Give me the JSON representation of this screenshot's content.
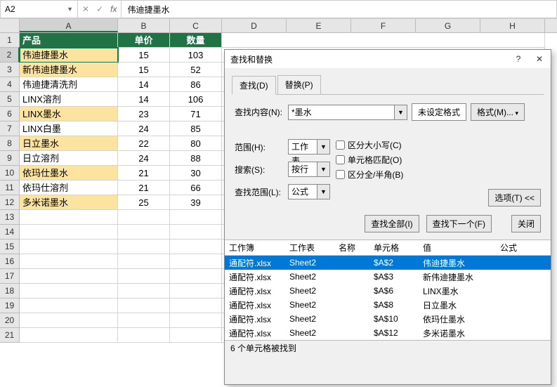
{
  "namebox": {
    "ref": "A2"
  },
  "formula_bar": {
    "value": "伟迪捷墨水"
  },
  "columns": [
    "A",
    "B",
    "C",
    "D",
    "E",
    "F",
    "G",
    "H"
  ],
  "active_col": "A",
  "active_row": 2,
  "header_row": {
    "product": "产品",
    "price": "单价",
    "qty": "数量"
  },
  "rows": [
    {
      "n": 1,
      "a": "产品",
      "b": "单价",
      "c": "数量",
      "hdr": true
    },
    {
      "n": 2,
      "a": "伟迪捷墨水",
      "b": "15",
      "c": "103",
      "hl": true,
      "active": true
    },
    {
      "n": 3,
      "a": "新伟迪捷墨水",
      "b": "15",
      "c": "52",
      "hl": true
    },
    {
      "n": 4,
      "a": "伟迪捷清洗剂",
      "b": "14",
      "c": "86"
    },
    {
      "n": 5,
      "a": "LINX溶剂",
      "b": "14",
      "c": "106"
    },
    {
      "n": 6,
      "a": "LINX墨水",
      "b": "23",
      "c": "71",
      "hl": true
    },
    {
      "n": 7,
      "a": "LINX白墨",
      "b": "24",
      "c": "85"
    },
    {
      "n": 8,
      "a": "日立墨水",
      "b": "22",
      "c": "80",
      "hl": true
    },
    {
      "n": 9,
      "a": "日立溶剂",
      "b": "24",
      "c": "88"
    },
    {
      "n": 10,
      "a": "依玛仕墨水",
      "b": "21",
      "c": "30",
      "hl": true
    },
    {
      "n": 11,
      "a": "依玛仕溶剂",
      "b": "21",
      "c": "66"
    },
    {
      "n": 12,
      "a": "多米诺墨水",
      "b": "25",
      "c": "39",
      "hl": true
    },
    {
      "n": 13,
      "a": "",
      "b": "",
      "c": ""
    },
    {
      "n": 14,
      "a": "",
      "b": "",
      "c": ""
    },
    {
      "n": 15,
      "a": "",
      "b": "",
      "c": ""
    },
    {
      "n": 16,
      "a": "",
      "b": "",
      "c": ""
    },
    {
      "n": 17,
      "a": "",
      "b": "",
      "c": ""
    },
    {
      "n": 18,
      "a": "",
      "b": "",
      "c": ""
    },
    {
      "n": 19,
      "a": "",
      "b": "",
      "c": ""
    },
    {
      "n": 20,
      "a": "",
      "b": "",
      "c": ""
    },
    {
      "n": 21,
      "a": "",
      "b": "",
      "c": ""
    }
  ],
  "dialog": {
    "title": "查找和替换",
    "help": "?",
    "close": "✕",
    "tabs": {
      "find": "查找(D)",
      "replace": "替换(P)",
      "active": "find"
    },
    "find_label": "查找内容(N):",
    "find_value": "*墨水",
    "no_format": "未设定格式",
    "format_btn": "格式(M)...",
    "scope_label": "范围(H):",
    "scope_value": "工作表",
    "search_label": "搜索(S):",
    "search_value": "按行",
    "lookin_label": "查找范围(L):",
    "lookin_value": "公式",
    "chk_case": "区分大小写(C)",
    "chk_whole": "单元格匹配(O)",
    "chk_width": "区分全/半角(B)",
    "options_btn": "选项(T) <<",
    "findall_btn": "查找全部(I)",
    "findnext_btn": "查找下一个(F)",
    "close_btn": "关闭",
    "res_headers": {
      "wb": "工作簿",
      "ws": "工作表",
      "nm": "名称",
      "cl": "单元格",
      "vl": "值",
      "fm": "公式"
    },
    "results": [
      {
        "wb": "通配符.xlsx",
        "ws": "Sheet2",
        "nm": "",
        "cl": "$A$2",
        "vl": "伟迪捷墨水",
        "sel": true
      },
      {
        "wb": "通配符.xlsx",
        "ws": "Sheet2",
        "nm": "",
        "cl": "$A$3",
        "vl": "新伟迪捷墨水"
      },
      {
        "wb": "通配符.xlsx",
        "ws": "Sheet2",
        "nm": "",
        "cl": "$A$6",
        "vl": "LINX墨水"
      },
      {
        "wb": "通配符.xlsx",
        "ws": "Sheet2",
        "nm": "",
        "cl": "$A$8",
        "vl": "日立墨水"
      },
      {
        "wb": "通配符.xlsx",
        "ws": "Sheet2",
        "nm": "",
        "cl": "$A$10",
        "vl": "依玛仕墨水"
      },
      {
        "wb": "通配符.xlsx",
        "ws": "Sheet2",
        "nm": "",
        "cl": "$A$12",
        "vl": "多米诺墨水"
      }
    ],
    "status": "6 个单元格被找到"
  },
  "colors": {
    "header_bg": "#217346",
    "highlight": "#FCE4A0",
    "select": "#0078d7"
  }
}
